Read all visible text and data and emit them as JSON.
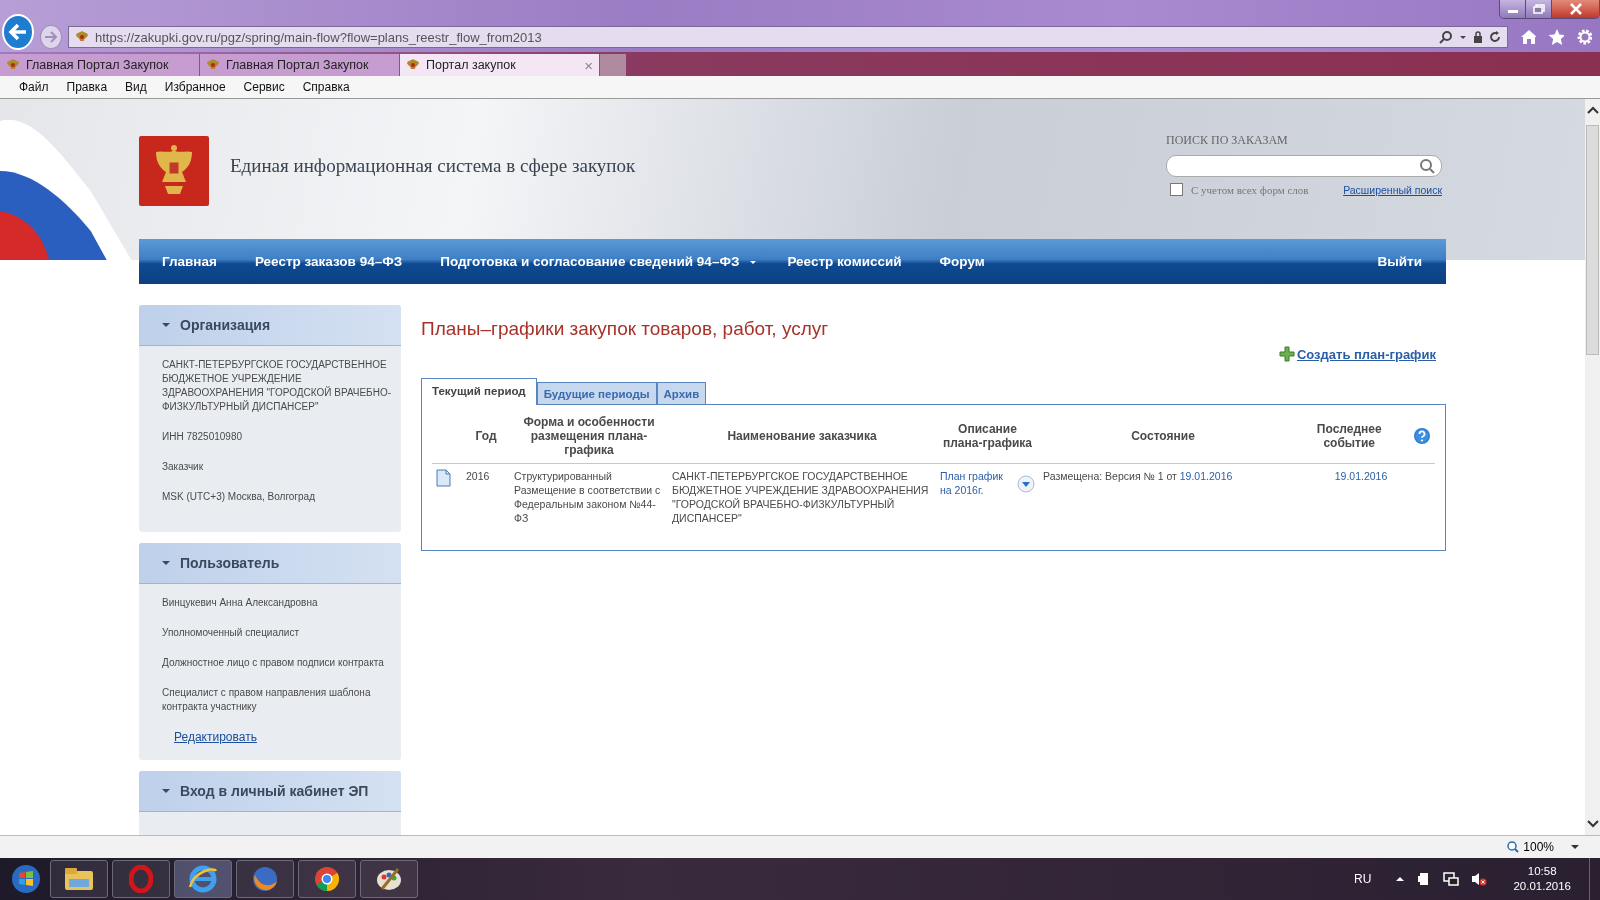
{
  "browser": {
    "address": "https://zakupki.gov.ru/pgz/spring/main-flow?flow=plans_reestr_flow_from2013",
    "tabs": [
      {
        "label": "Главная Портал Закупок",
        "selected": false
      },
      {
        "label": "Главная Портал Закупок",
        "selected": false
      },
      {
        "label": "Портал закупок",
        "selected": true
      }
    ],
    "tab_close": "×",
    "menu": [
      "Файл",
      "Правка",
      "Вид",
      "Избранное",
      "Сервис",
      "Справка"
    ]
  },
  "header": {
    "title": "Единая информационная система в сфере закупок",
    "search_label": "ПОИСК ПО ЗАКАЗАМ",
    "search_option": {
      "label": "С учетом всех форм слов",
      "checked": false
    },
    "advanced_search": "Расширенный поиск"
  },
  "nav": [
    {
      "label": "Главная",
      "dropdown": false
    },
    {
      "label": "Реестр заказов 94–ФЗ",
      "dropdown": false
    },
    {
      "label": "Подготовка и согласование сведений 94–ФЗ",
      "dropdown": true
    },
    {
      "label": "Реестр комиссий",
      "dropdown": false
    },
    {
      "label": "Форум",
      "dropdown": false
    }
  ],
  "logout": "Выйти",
  "sidebar": [
    {
      "title": "Организация",
      "expanded": true,
      "lines": [
        "САНКТ-ПЕТЕРБУРГСКОЕ ГОСУДАРСТВЕННОЕ БЮДЖЕТНОЕ УЧРЕЖДЕНИЕ ЗДРАВООХРАНЕНИЯ \"ГОРОДСКОЙ ВРАЧЕБНО-ФИЗКУЛЬТУРНЫЙ ДИСПАНСЕР\"",
        "ИНН 7825010980",
        "Заказчик",
        "MSK (UTC+3) Москва, Волгоград"
      ]
    },
    {
      "title": "Пользователь",
      "expanded": true,
      "lines": [
        "Винцукевич Анна Александровна",
        "Уполномоченный специалист",
        "Должностное лицо с правом подписи контракта",
        "Специалист с правом направления шаблона контракта участнику"
      ],
      "link": "Редактировать"
    },
    {
      "title": "Вход в личный кабинет ЭП",
      "expanded": true
    }
  ],
  "main": {
    "title": "Планы–графики закупок товаров, работ, услуг",
    "create_link": "Создать план-график",
    "tabs": [
      {
        "label": "Текущий период",
        "selected": true
      },
      {
        "label": "Будущие периоды",
        "selected": false
      },
      {
        "label": "Архив",
        "selected": false
      }
    ],
    "table": {
      "columns": [
        "Год",
        "Форма и особенности размещения плана-графика",
        "Наименование заказчика",
        "Описание плана-графика",
        "Состояние",
        "Последнее событие"
      ],
      "rows": [
        {
          "year": "2016",
          "form": "Структурированный Размещение в соответствии с Федеральным законом №44-ФЗ",
          "customer": "САНКТ-ПЕТЕРБУРГСКОЕ ГОСУДАРСТВЕННОЕ БЮДЖЕТНОЕ УЧРЕЖДЕНИЕ ЗДРАВООХРАНЕНИЯ \"ГОРОДСКОЙ ВРАЧЕБНО-ФИЗКУЛЬТУРНЫЙ ДИСПАНСЕР\"",
          "description": "План график на 2016г.",
          "status": "Размещена: Версия №  1 от",
          "status_date": "19.01.2016",
          "last_event": "19.01.2016"
        }
      ]
    }
  },
  "status_bar": {
    "zoom": "100%"
  },
  "taskbar": {
    "language": "RU",
    "time": "10:58",
    "date": "20.01.2016"
  }
}
